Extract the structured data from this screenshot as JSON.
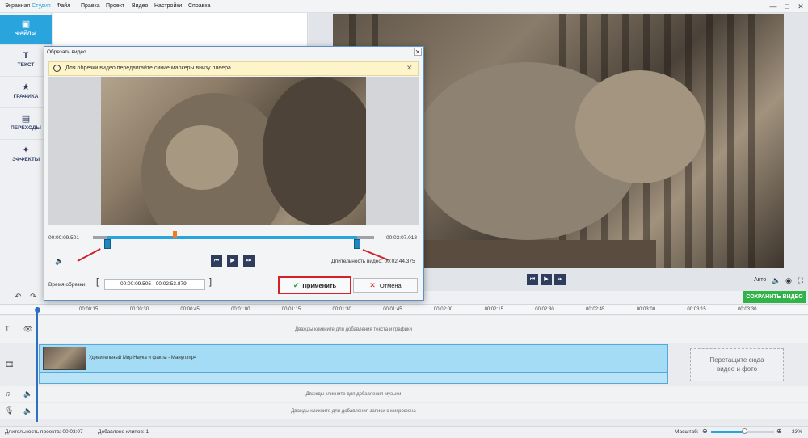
{
  "app": {
    "title_part1": "Экранная ",
    "title_part2": "Студия",
    "menu": [
      "Файл",
      "Правка",
      "Проект",
      "Видео",
      "Настройки",
      "Справка"
    ],
    "window_buttons": [
      "—",
      "□",
      "✕"
    ]
  },
  "sidebar": {
    "tabs": [
      {
        "label": "ФАЙЛЫ",
        "icon": "▣"
      },
      {
        "label": "ТЕКСТ",
        "icon": "T"
      },
      {
        "label": "ГРАФИКА",
        "icon": "★"
      },
      {
        "label": "ПЕРЕХОДЫ",
        "icon": "▤"
      },
      {
        "label": "ЭФФЕКТЫ",
        "icon": "✦"
      }
    ]
  },
  "dialog": {
    "title": "Обрезать видео",
    "close": "✕",
    "hint_icon": "!",
    "hint": "Для обрезки видео передвигайте синие маркеры внизу плеера.",
    "hint_close": "✕",
    "time_start": "00:00:09.501",
    "time_end": "00:03:07.018",
    "duration": "Длительность видео: 00:02:44.375",
    "trim_label": "Время обрезки:",
    "trim_value": "00:00:09.505 - 00:02:53.879",
    "apply": "Применить",
    "cancel": "Отмена",
    "apply_icon": "✔",
    "cancel_icon": "✕",
    "trim_start_fraction": 0.051,
    "trim_end_fraction": 0.94,
    "position_fraction": 0.29
  },
  "preview": {
    "auto": "Авто",
    "save": "СОХРАНИТЬ ВИДЕО",
    "controls": [
      "⏮",
      "▶",
      "⏭"
    ]
  },
  "timeline": {
    "ticks": [
      "00:00:15",
      "00:00:30",
      "00:00:45",
      "00:01:00",
      "00:01:15",
      "00:01:30",
      "00:01:45",
      "00:02:00",
      "00:02:15",
      "00:02:30",
      "00:02:45",
      "00:03:00",
      "00:03:15",
      "00:03:30"
    ],
    "text_hint": "Дважды кликните для добавления текста и графики",
    "clip_title": "Удивительный Мир  Наука и факты - Манул.mp4",
    "drop_text_1": "Перетащите сюда",
    "drop_text_2": "видео и фото",
    "music_hint": "Дважды кликните для добавления музыки",
    "mic_hint": "Дважды кликните для добавления записи с микрофона"
  },
  "status": {
    "project_duration": "Длительность проекта:  00:03:07",
    "clips_added": "Добавлено клипов: 1",
    "zoom_label": "Масштаб:",
    "zoom_value": "33%",
    "zoom_fraction": 0.52
  },
  "colors": {
    "accent": "#2aa4dc",
    "save_green": "#32b34a",
    "highlight_red": "#d42027",
    "trim_marker": "#1f86c0"
  }
}
